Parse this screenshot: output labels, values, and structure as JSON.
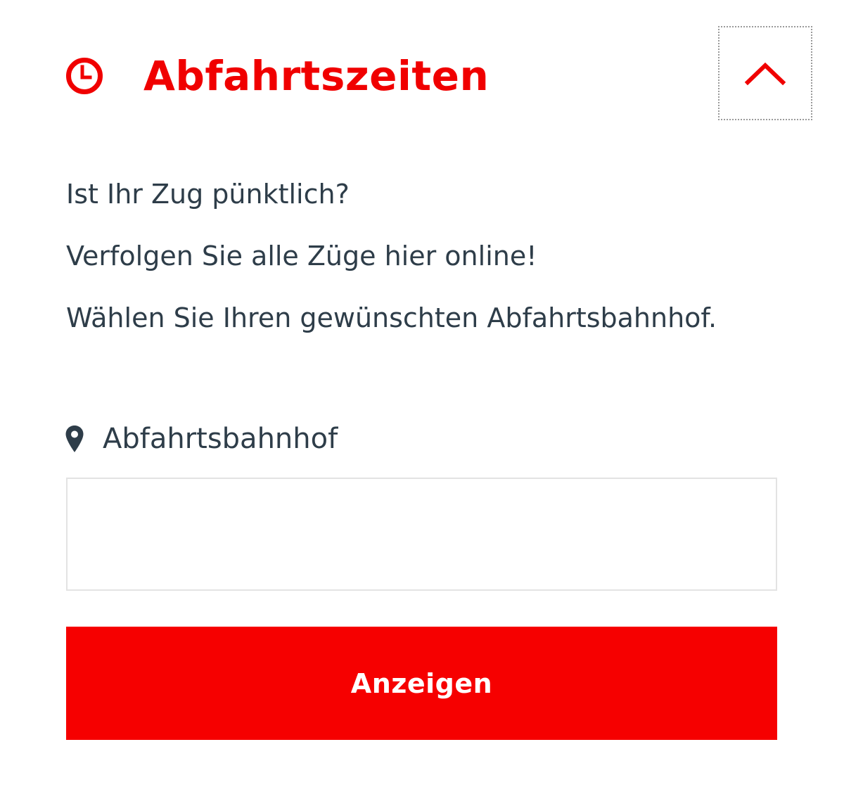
{
  "colors": {
    "accent": "#f00000",
    "button_background": "#f60000",
    "button_text": "#ffffff",
    "body_text": "#2e3d49",
    "input_border": "#e3e3e3"
  },
  "header": {
    "icon": "clock-icon",
    "title": "Abfahrtszeiten",
    "collapse_icon": "chevron-up-icon"
  },
  "intro": {
    "lines": [
      "Ist Ihr Zug pünktlich?",
      "Verfolgen Sie alle Züge hier online!",
      "Wählen Sie Ihren gewünschten Abfahrtsbahnhof."
    ]
  },
  "station_field": {
    "icon": "map-pin-icon",
    "label": "Abfahrtsbahnhof",
    "value": ""
  },
  "submit": {
    "label": "Anzeigen"
  }
}
